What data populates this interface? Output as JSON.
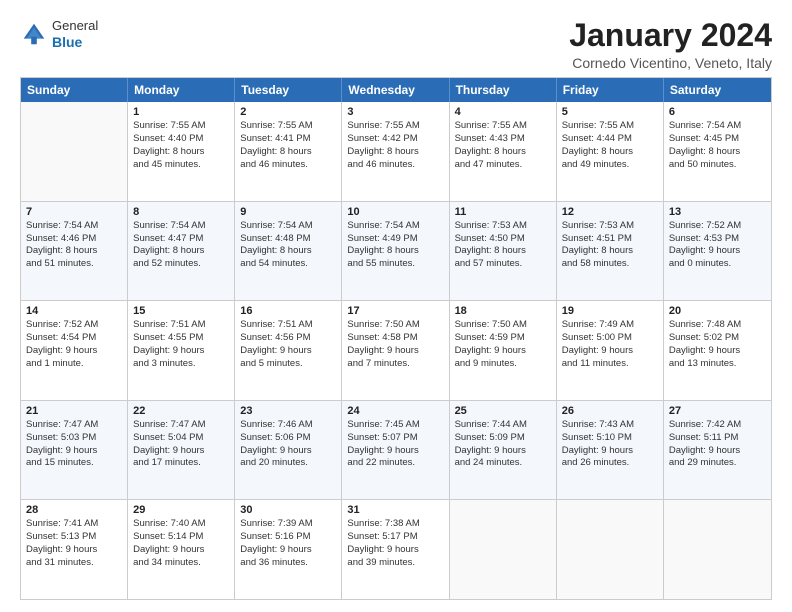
{
  "header": {
    "logo_general": "General",
    "logo_blue": "Blue",
    "month_title": "January 2024",
    "location": "Cornedo Vicentino, Veneto, Italy"
  },
  "weekdays": [
    "Sunday",
    "Monday",
    "Tuesday",
    "Wednesday",
    "Thursday",
    "Friday",
    "Saturday"
  ],
  "rows": [
    [
      {
        "day": "",
        "lines": []
      },
      {
        "day": "1",
        "lines": [
          "Sunrise: 7:55 AM",
          "Sunset: 4:40 PM",
          "Daylight: 8 hours",
          "and 45 minutes."
        ]
      },
      {
        "day": "2",
        "lines": [
          "Sunrise: 7:55 AM",
          "Sunset: 4:41 PM",
          "Daylight: 8 hours",
          "and 46 minutes."
        ]
      },
      {
        "day": "3",
        "lines": [
          "Sunrise: 7:55 AM",
          "Sunset: 4:42 PM",
          "Daylight: 8 hours",
          "and 46 minutes."
        ]
      },
      {
        "day": "4",
        "lines": [
          "Sunrise: 7:55 AM",
          "Sunset: 4:43 PM",
          "Daylight: 8 hours",
          "and 47 minutes."
        ]
      },
      {
        "day": "5",
        "lines": [
          "Sunrise: 7:55 AM",
          "Sunset: 4:44 PM",
          "Daylight: 8 hours",
          "and 49 minutes."
        ]
      },
      {
        "day": "6",
        "lines": [
          "Sunrise: 7:54 AM",
          "Sunset: 4:45 PM",
          "Daylight: 8 hours",
          "and 50 minutes."
        ]
      }
    ],
    [
      {
        "day": "7",
        "lines": [
          "Sunrise: 7:54 AM",
          "Sunset: 4:46 PM",
          "Daylight: 8 hours",
          "and 51 minutes."
        ]
      },
      {
        "day": "8",
        "lines": [
          "Sunrise: 7:54 AM",
          "Sunset: 4:47 PM",
          "Daylight: 8 hours",
          "and 52 minutes."
        ]
      },
      {
        "day": "9",
        "lines": [
          "Sunrise: 7:54 AM",
          "Sunset: 4:48 PM",
          "Daylight: 8 hours",
          "and 54 minutes."
        ]
      },
      {
        "day": "10",
        "lines": [
          "Sunrise: 7:54 AM",
          "Sunset: 4:49 PM",
          "Daylight: 8 hours",
          "and 55 minutes."
        ]
      },
      {
        "day": "11",
        "lines": [
          "Sunrise: 7:53 AM",
          "Sunset: 4:50 PM",
          "Daylight: 8 hours",
          "and 57 minutes."
        ]
      },
      {
        "day": "12",
        "lines": [
          "Sunrise: 7:53 AM",
          "Sunset: 4:51 PM",
          "Daylight: 8 hours",
          "and 58 minutes."
        ]
      },
      {
        "day": "13",
        "lines": [
          "Sunrise: 7:52 AM",
          "Sunset: 4:53 PM",
          "Daylight: 9 hours",
          "and 0 minutes."
        ]
      }
    ],
    [
      {
        "day": "14",
        "lines": [
          "Sunrise: 7:52 AM",
          "Sunset: 4:54 PM",
          "Daylight: 9 hours",
          "and 1 minute."
        ]
      },
      {
        "day": "15",
        "lines": [
          "Sunrise: 7:51 AM",
          "Sunset: 4:55 PM",
          "Daylight: 9 hours",
          "and 3 minutes."
        ]
      },
      {
        "day": "16",
        "lines": [
          "Sunrise: 7:51 AM",
          "Sunset: 4:56 PM",
          "Daylight: 9 hours",
          "and 5 minutes."
        ]
      },
      {
        "day": "17",
        "lines": [
          "Sunrise: 7:50 AM",
          "Sunset: 4:58 PM",
          "Daylight: 9 hours",
          "and 7 minutes."
        ]
      },
      {
        "day": "18",
        "lines": [
          "Sunrise: 7:50 AM",
          "Sunset: 4:59 PM",
          "Daylight: 9 hours",
          "and 9 minutes."
        ]
      },
      {
        "day": "19",
        "lines": [
          "Sunrise: 7:49 AM",
          "Sunset: 5:00 PM",
          "Daylight: 9 hours",
          "and 11 minutes."
        ]
      },
      {
        "day": "20",
        "lines": [
          "Sunrise: 7:48 AM",
          "Sunset: 5:02 PM",
          "Daylight: 9 hours",
          "and 13 minutes."
        ]
      }
    ],
    [
      {
        "day": "21",
        "lines": [
          "Sunrise: 7:47 AM",
          "Sunset: 5:03 PM",
          "Daylight: 9 hours",
          "and 15 minutes."
        ]
      },
      {
        "day": "22",
        "lines": [
          "Sunrise: 7:47 AM",
          "Sunset: 5:04 PM",
          "Daylight: 9 hours",
          "and 17 minutes."
        ]
      },
      {
        "day": "23",
        "lines": [
          "Sunrise: 7:46 AM",
          "Sunset: 5:06 PM",
          "Daylight: 9 hours",
          "and 20 minutes."
        ]
      },
      {
        "day": "24",
        "lines": [
          "Sunrise: 7:45 AM",
          "Sunset: 5:07 PM",
          "Daylight: 9 hours",
          "and 22 minutes."
        ]
      },
      {
        "day": "25",
        "lines": [
          "Sunrise: 7:44 AM",
          "Sunset: 5:09 PM",
          "Daylight: 9 hours",
          "and 24 minutes."
        ]
      },
      {
        "day": "26",
        "lines": [
          "Sunrise: 7:43 AM",
          "Sunset: 5:10 PM",
          "Daylight: 9 hours",
          "and 26 minutes."
        ]
      },
      {
        "day": "27",
        "lines": [
          "Sunrise: 7:42 AM",
          "Sunset: 5:11 PM",
          "Daylight: 9 hours",
          "and 29 minutes."
        ]
      }
    ],
    [
      {
        "day": "28",
        "lines": [
          "Sunrise: 7:41 AM",
          "Sunset: 5:13 PM",
          "Daylight: 9 hours",
          "and 31 minutes."
        ]
      },
      {
        "day": "29",
        "lines": [
          "Sunrise: 7:40 AM",
          "Sunset: 5:14 PM",
          "Daylight: 9 hours",
          "and 34 minutes."
        ]
      },
      {
        "day": "30",
        "lines": [
          "Sunrise: 7:39 AM",
          "Sunset: 5:16 PM",
          "Daylight: 9 hours",
          "and 36 minutes."
        ]
      },
      {
        "day": "31",
        "lines": [
          "Sunrise: 7:38 AM",
          "Sunset: 5:17 PM",
          "Daylight: 9 hours",
          "and 39 minutes."
        ]
      },
      {
        "day": "",
        "lines": []
      },
      {
        "day": "",
        "lines": []
      },
      {
        "day": "",
        "lines": []
      }
    ]
  ]
}
